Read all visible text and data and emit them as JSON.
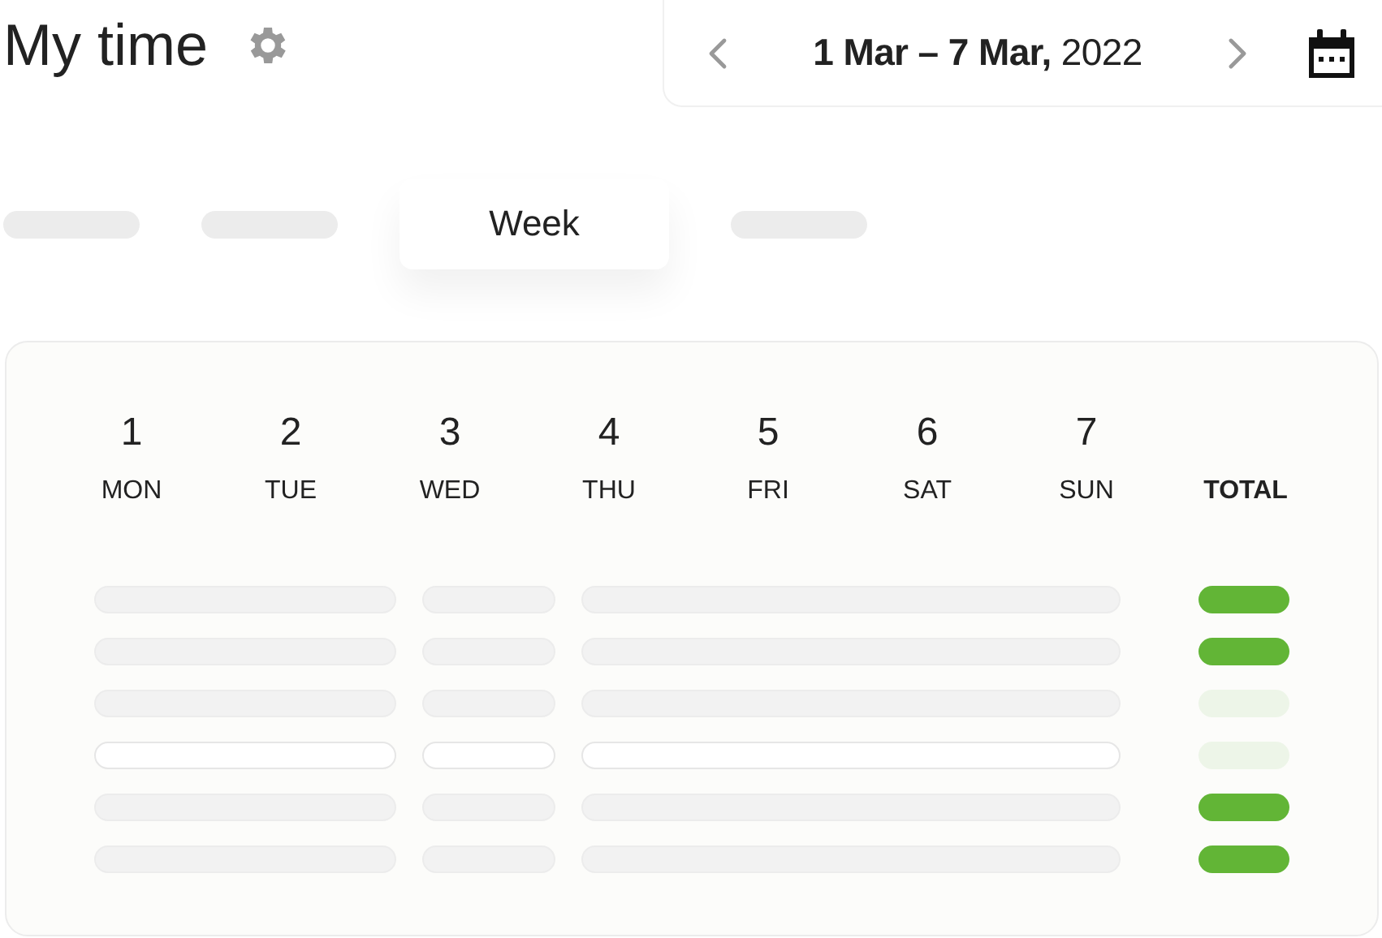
{
  "header": {
    "title": "My time",
    "date_range": "**1 Mar – 7 Mar,** 2022"
  },
  "tabs": [
    {
      "selected": false
    },
    {
      "selected": false
    },
    {
      "label": "Week",
      "selected": true
    },
    {
      "selected": false
    }
  ],
  "days": [
    {
      "number": "1",
      "name": "MON"
    },
    {
      "number": "2",
      "name": "TUE"
    },
    {
      "number": "3",
      "name": "WED"
    },
    {
      "number": "4",
      "name": "THU"
    },
    {
      "number": "5",
      "name": "FRI"
    },
    {
      "number": "6",
      "name": "SAT"
    },
    {
      "number": "7",
      "name": "SUN"
    }
  ],
  "total_label": "TOTAL",
  "rows": [
    {
      "kind": "filled",
      "color": "#62b536"
    },
    {
      "kind": "filled",
      "color": "#62b536"
    },
    {
      "kind": "filled",
      "color": "#edf5e8"
    },
    {
      "kind": "outlined",
      "color": "#edf5e8"
    },
    {
      "kind": "filled",
      "color": "#62b536"
    },
    {
      "kind": "filled",
      "color": "#62b536"
    }
  ]
}
